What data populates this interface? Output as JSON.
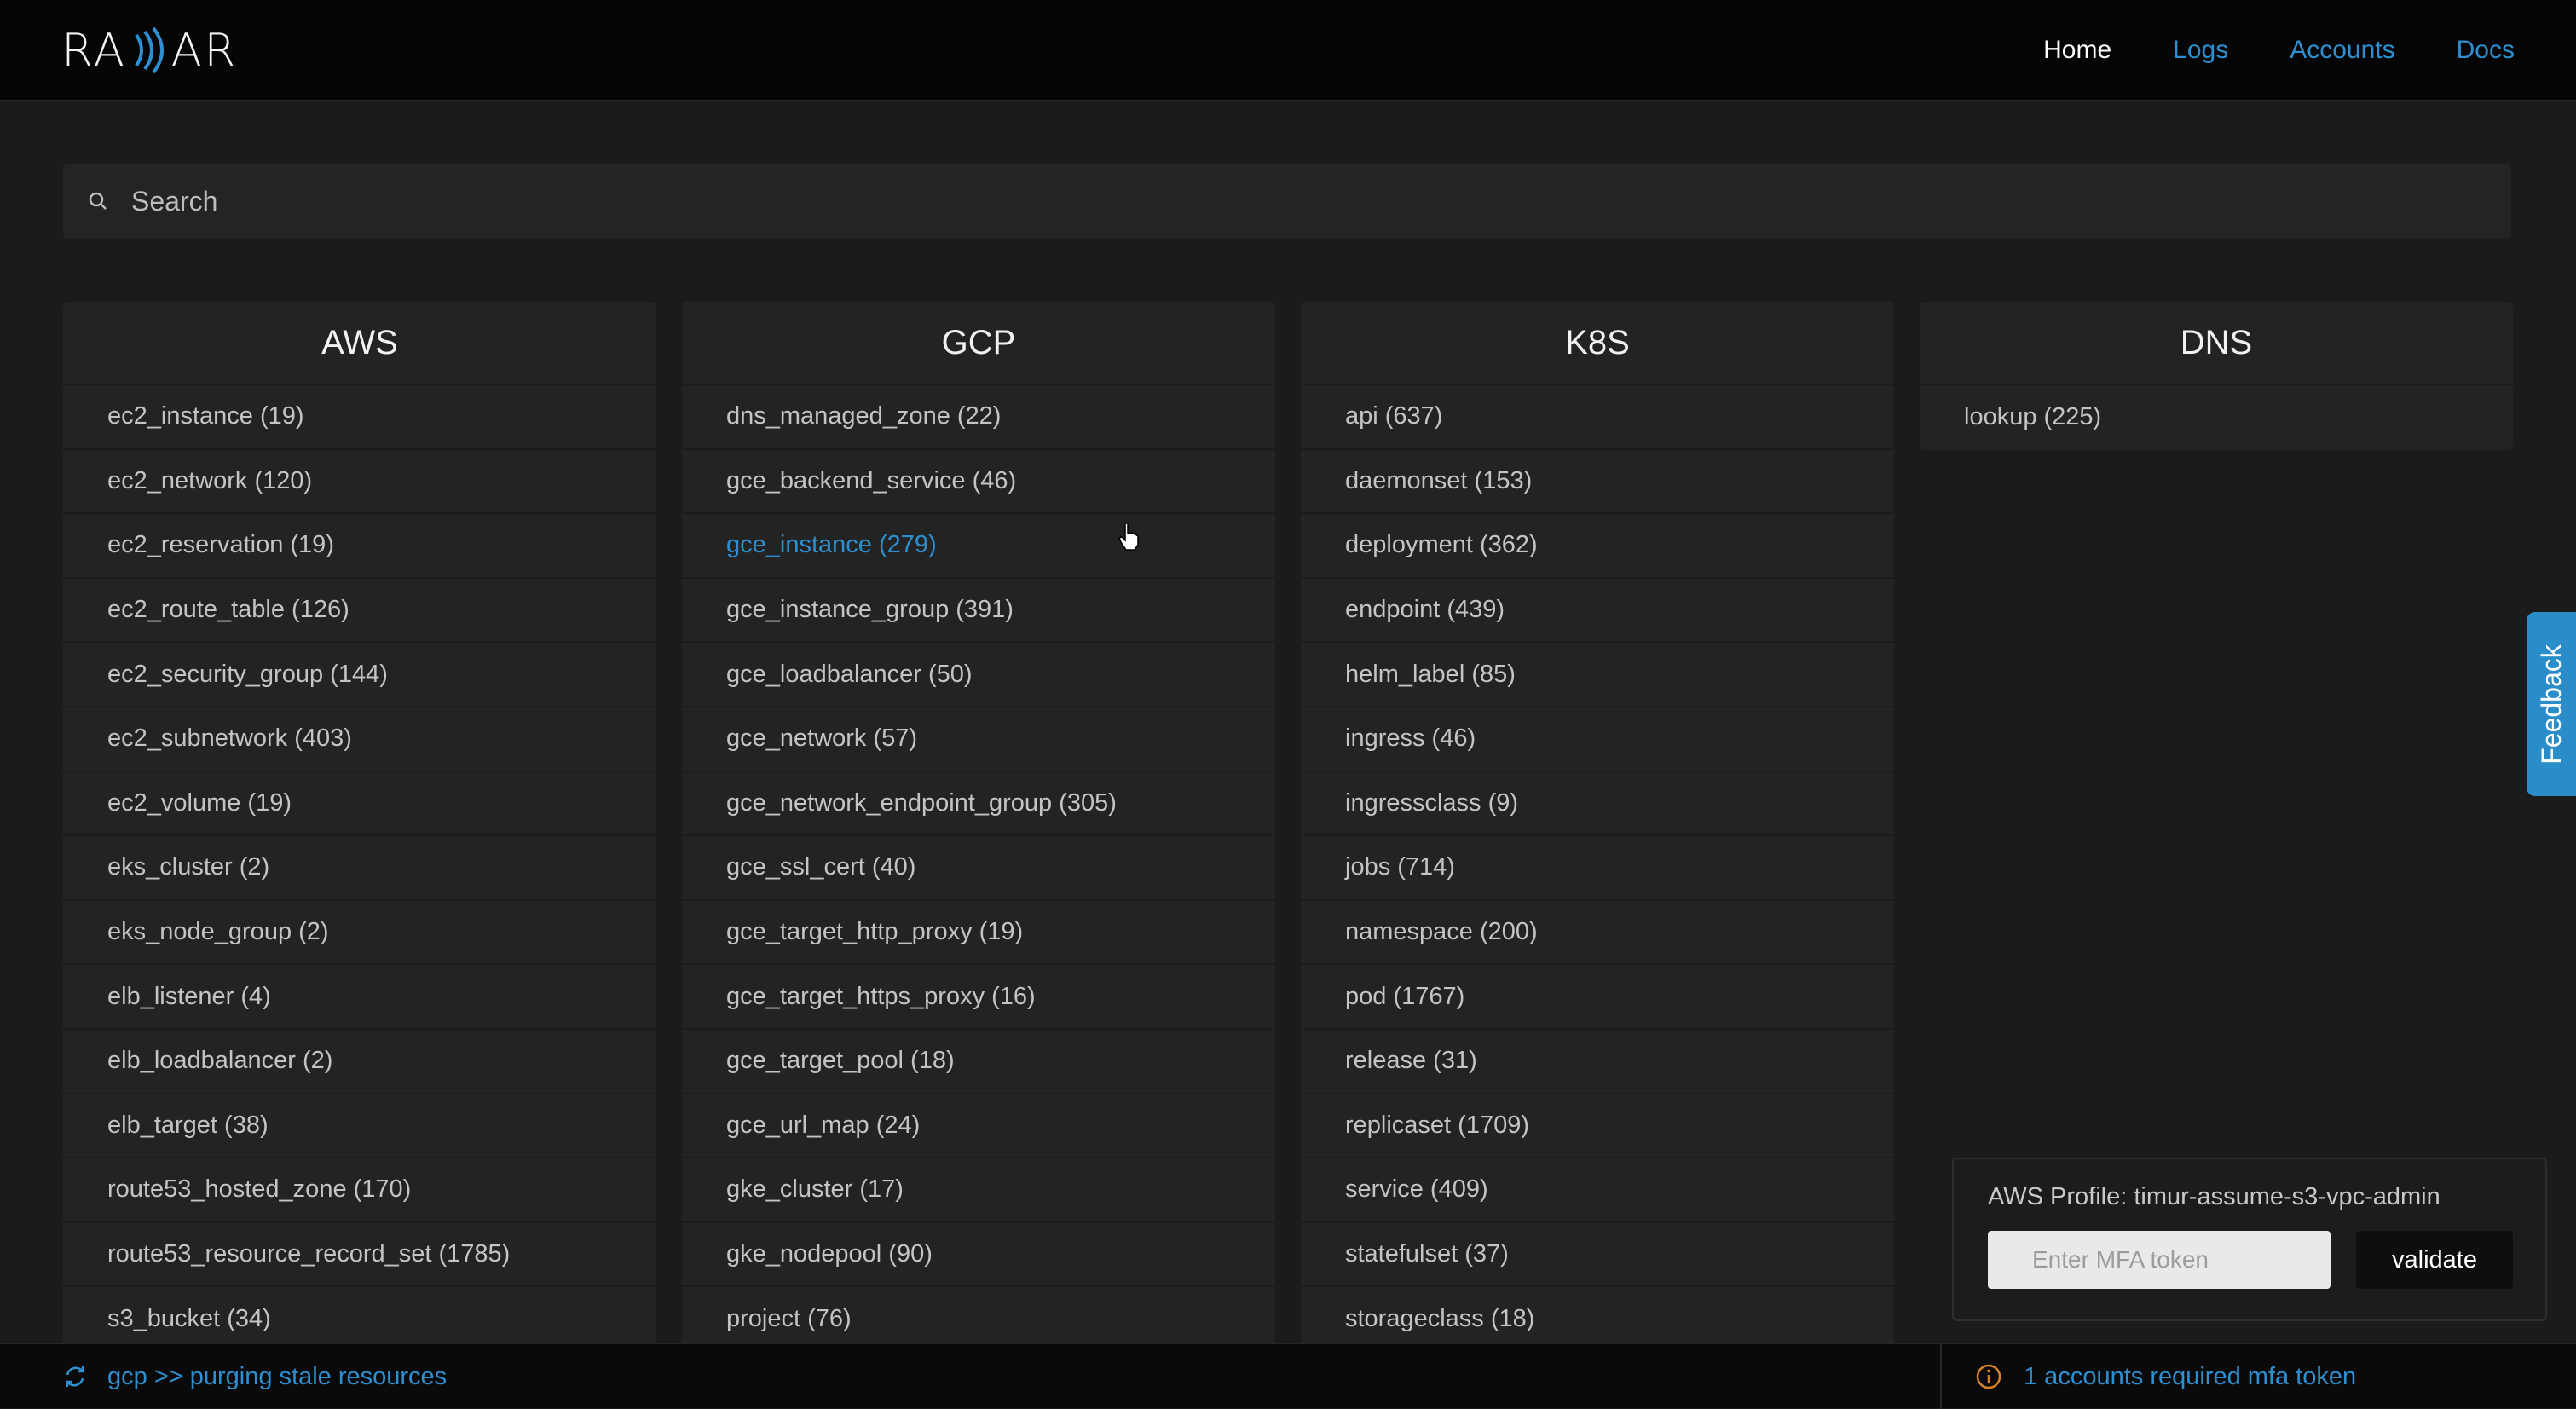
{
  "header": {
    "logo_text_left": "RA",
    "logo_text_right": "AR",
    "nav": [
      {
        "label": "Home"
      },
      {
        "label": "Logs"
      },
      {
        "label": "Accounts"
      },
      {
        "label": "Docs"
      }
    ]
  },
  "search": {
    "placeholder": "Search"
  },
  "columns": [
    {
      "title": "AWS",
      "items": [
        "ec2_instance (19)",
        "ec2_network (120)",
        "ec2_reservation (19)",
        "ec2_route_table (126)",
        "ec2_security_group (144)",
        "ec2_subnetwork (403)",
        "ec2_volume (19)",
        "eks_cluster (2)",
        "eks_node_group (2)",
        "elb_listener (4)",
        "elb_loadbalancer (2)",
        "elb_target (38)",
        "route53_hosted_zone (170)",
        "route53_resource_record_set (1785)",
        "s3_bucket (34)"
      ]
    },
    {
      "title": "GCP",
      "items": [
        "dns_managed_zone (22)",
        "gce_backend_service (46)",
        "gce_instance (279)",
        "gce_instance_group (391)",
        "gce_loadbalancer (50)",
        "gce_network (57)",
        "gce_network_endpoint_group (305)",
        "gce_ssl_cert (40)",
        "gce_target_http_proxy (19)",
        "gce_target_https_proxy (16)",
        "gce_target_pool (18)",
        "gce_url_map (24)",
        "gke_cluster (17)",
        "gke_nodepool (90)",
        "project (76)"
      ]
    },
    {
      "title": "K8S",
      "items": [
        "api (637)",
        "daemonset (153)",
        "deployment (362)",
        "endpoint (439)",
        "helm_label (85)",
        "ingress (46)",
        "ingressclass (9)",
        "jobs (714)",
        "namespace (200)",
        "pod (1767)",
        "release (31)",
        "replicaset (1709)",
        "service (409)",
        "statefulset (37)",
        "storageclass (18)"
      ]
    },
    {
      "title": "DNS",
      "items": [
        "lookup (225)"
      ]
    }
  ],
  "feedback": {
    "label": "Feedback"
  },
  "mfa": {
    "profile": "AWS Profile: timur-assume-s3-vpc-admin",
    "placeholder": "Enter MFA token",
    "button": "validate"
  },
  "footer": {
    "status_left": "gcp >> purging stale resources",
    "status_right": "1 accounts required mfa token"
  },
  "colors": {
    "accent": "#2e8fd0",
    "background": "#1b1b1b",
    "panel": "#232323",
    "header": "#050505"
  }
}
